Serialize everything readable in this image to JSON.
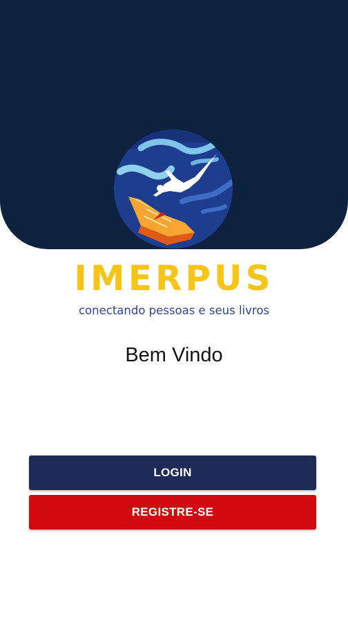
{
  "brand": {
    "name": "IMERPUS",
    "tagline": "conectando pessoas e seus livros",
    "logo_icon": "globe-diver-book-logo"
  },
  "welcome_text": "Bem Vindo",
  "buttons": {
    "login_label": "LOGIN",
    "register_label": "REGISTRE-SE"
  },
  "colors": {
    "header_background": "#0d223f",
    "brand_yellow": "#f5c518",
    "tagline_blue": "#33458c",
    "login_button": "#1f2b57",
    "register_button": "#d0090f"
  }
}
